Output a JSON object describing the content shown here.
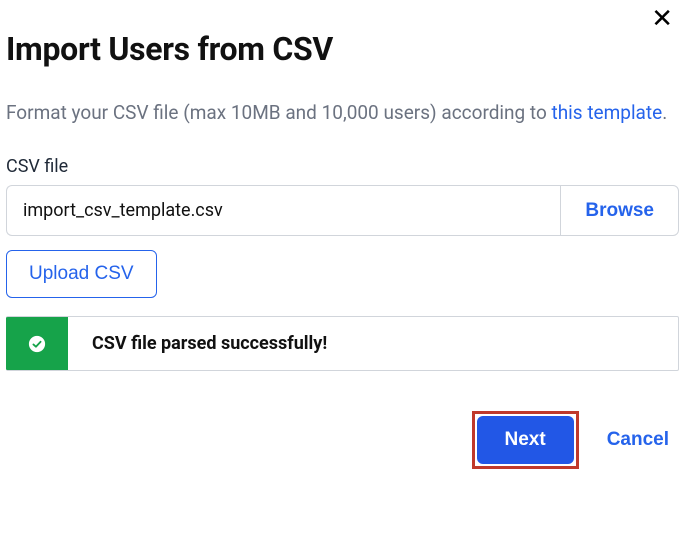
{
  "dialog": {
    "title": "Import Users from CSV",
    "description_prefix": "Format your CSV file (max 10MB and 10,000 users) according to ",
    "template_link_text": "this template",
    "description_suffix": "."
  },
  "file_field": {
    "label": "CSV file",
    "value": "import_csv_template.csv",
    "browse_label": "Browse"
  },
  "upload_button_label": "Upload CSV",
  "status": {
    "message": "CSV file parsed successfully!"
  },
  "footer": {
    "next_label": "Next",
    "cancel_label": "Cancel"
  }
}
